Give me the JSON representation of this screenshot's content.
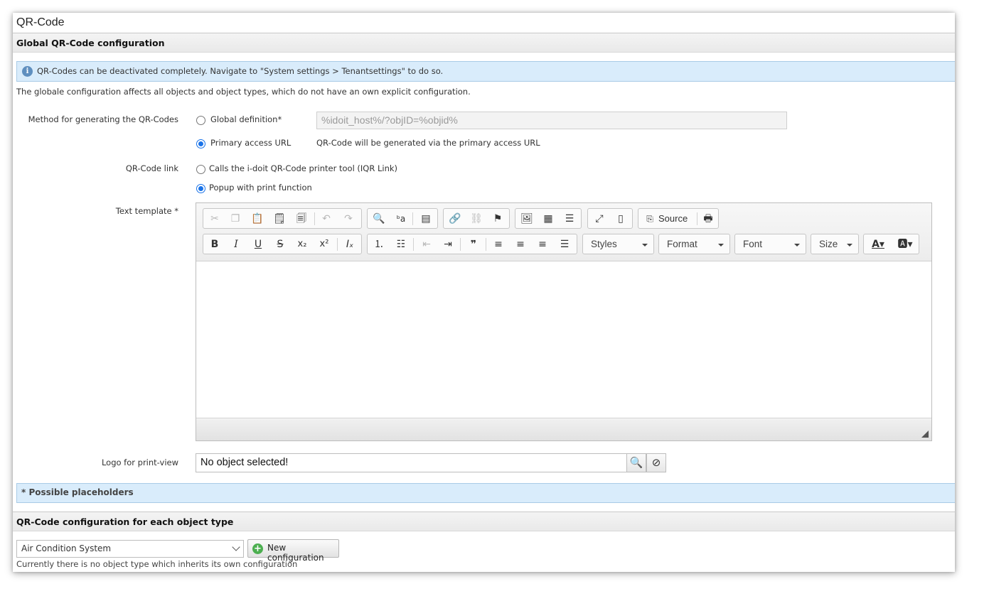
{
  "page": {
    "title": "QR-Code"
  },
  "global": {
    "heading": "Global QR-Code configuration",
    "info": "QR-Codes can be deactivated completely. Navigate to \"System settings > Tenantsettings\" to do so.",
    "description": "The globale configuration affects all objects and object types, which do not have an own explicit configuration.",
    "method": {
      "label": "Method for generating the QR-Codes",
      "option_global": "Global definition*",
      "global_value": "%idoit_host%/?objID=%objid%",
      "option_primary": "Primary access URL",
      "primary_hint": "QR-Code will be generated via the primary access URL",
      "selected": "primary"
    },
    "link": {
      "label": "QR-Code link",
      "option_iqr": "Calls the i-doit QR-Code printer tool (IQR Link)",
      "option_popup": "Popup with print function",
      "selected": "popup"
    },
    "template": {
      "label": "Text template *",
      "source_label": "Source",
      "styles": "Styles",
      "format": "Format",
      "font": "Font",
      "size": "Size"
    },
    "logo": {
      "label": "Logo for print-view",
      "value": "No object selected!"
    },
    "placeholders": "* Possible placeholders"
  },
  "per_type": {
    "heading": "QR-Code configuration for each object type",
    "selected_type": "Air Condition System",
    "new_button": "New configuration",
    "note": "Currently there is no object type which inherits its own configuration"
  }
}
